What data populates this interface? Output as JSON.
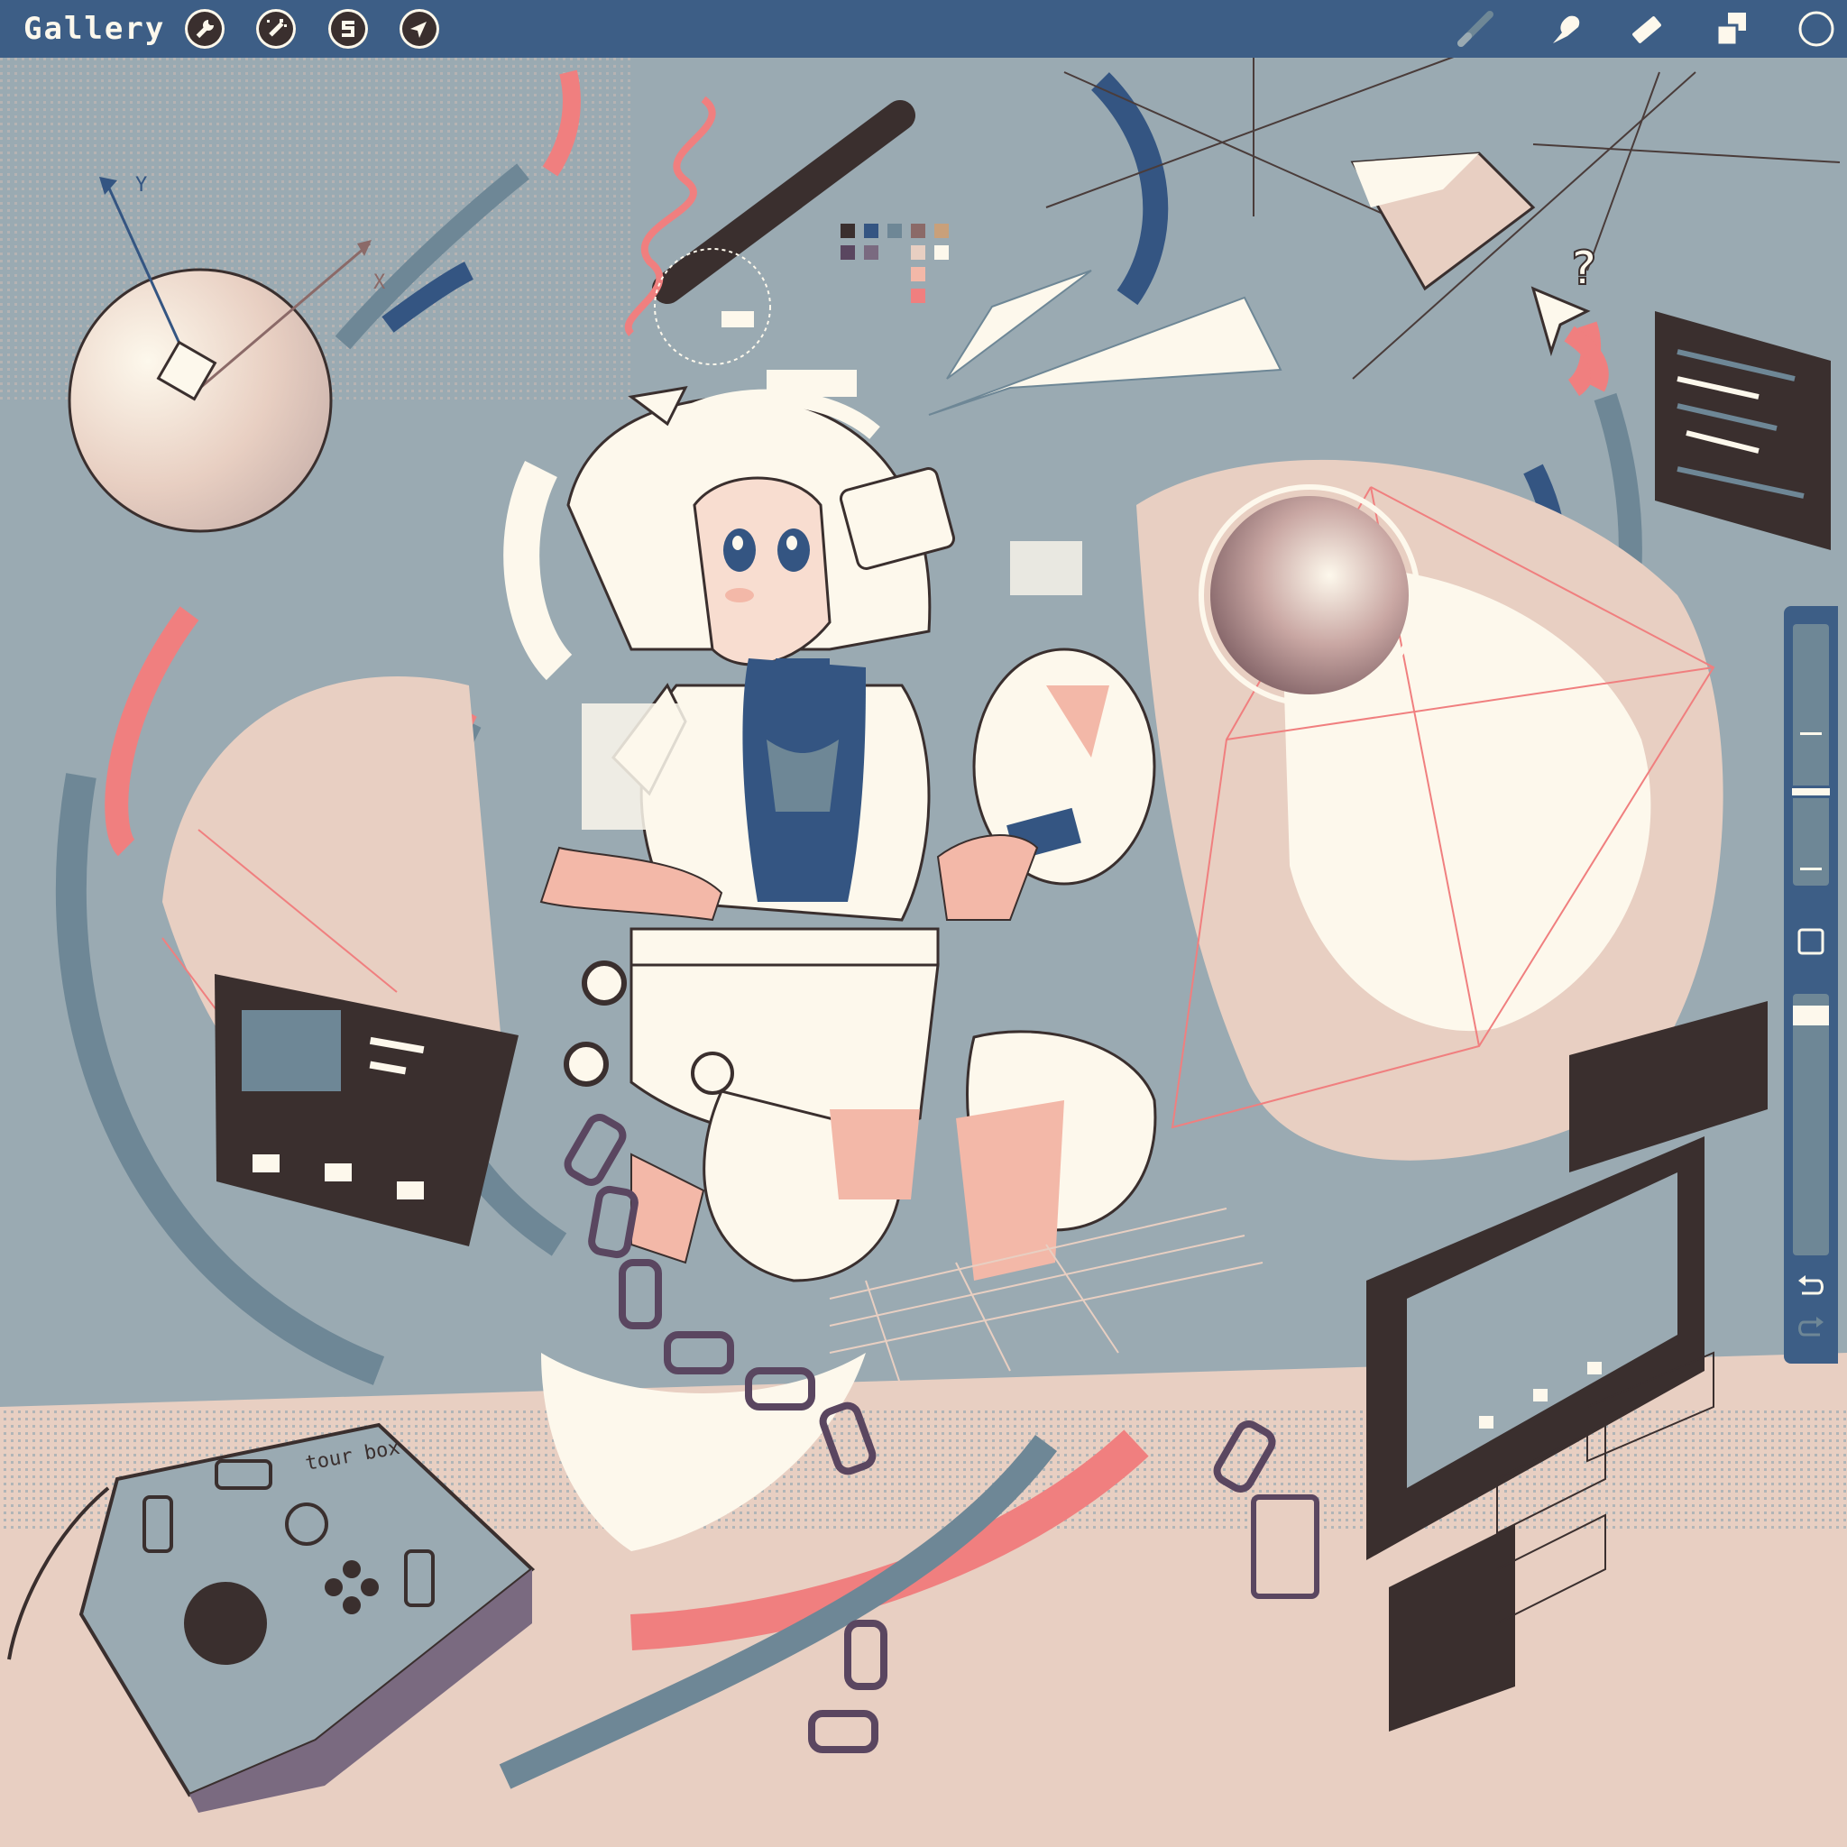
{
  "app": {
    "gallery_label": "Gallery"
  },
  "toolbar": {
    "left_tools": [
      {
        "name": "actions",
        "icon": "wrench-icon"
      },
      {
        "name": "adjustments",
        "icon": "magic-wand-icon"
      },
      {
        "name": "selection",
        "icon": "selection-s-icon"
      },
      {
        "name": "transform",
        "icon": "arrow-cursor-icon"
      }
    ],
    "right_tools": [
      {
        "name": "brush",
        "icon": "brush-icon"
      },
      {
        "name": "smudge",
        "icon": "smudge-finger-icon"
      },
      {
        "name": "eraser",
        "icon": "eraser-icon"
      },
      {
        "name": "layers",
        "icon": "layers-icon"
      },
      {
        "name": "color",
        "icon": "color-circle-icon"
      }
    ]
  },
  "sidebar": {
    "brush_size": 0.35,
    "opacity": 0.95,
    "modify_icon": "square-icon",
    "undo_icon": "undo-arrow-icon",
    "redo_icon": "redo-arrow-icon"
  },
  "artwork": {
    "controller_text": "tour box",
    "question_mark": "?",
    "axis_y": "Y",
    "axis_x": "X"
  },
  "colors": {
    "toolbar": "#3d5e86",
    "canvas_bg": "#9aaab2",
    "cream": "#fdf8ec",
    "skin": "#e8cfc2",
    "pink": "#f07f7f",
    "dark": "#3a2f2e",
    "navy": "#345582",
    "slate": "#6e8796"
  }
}
